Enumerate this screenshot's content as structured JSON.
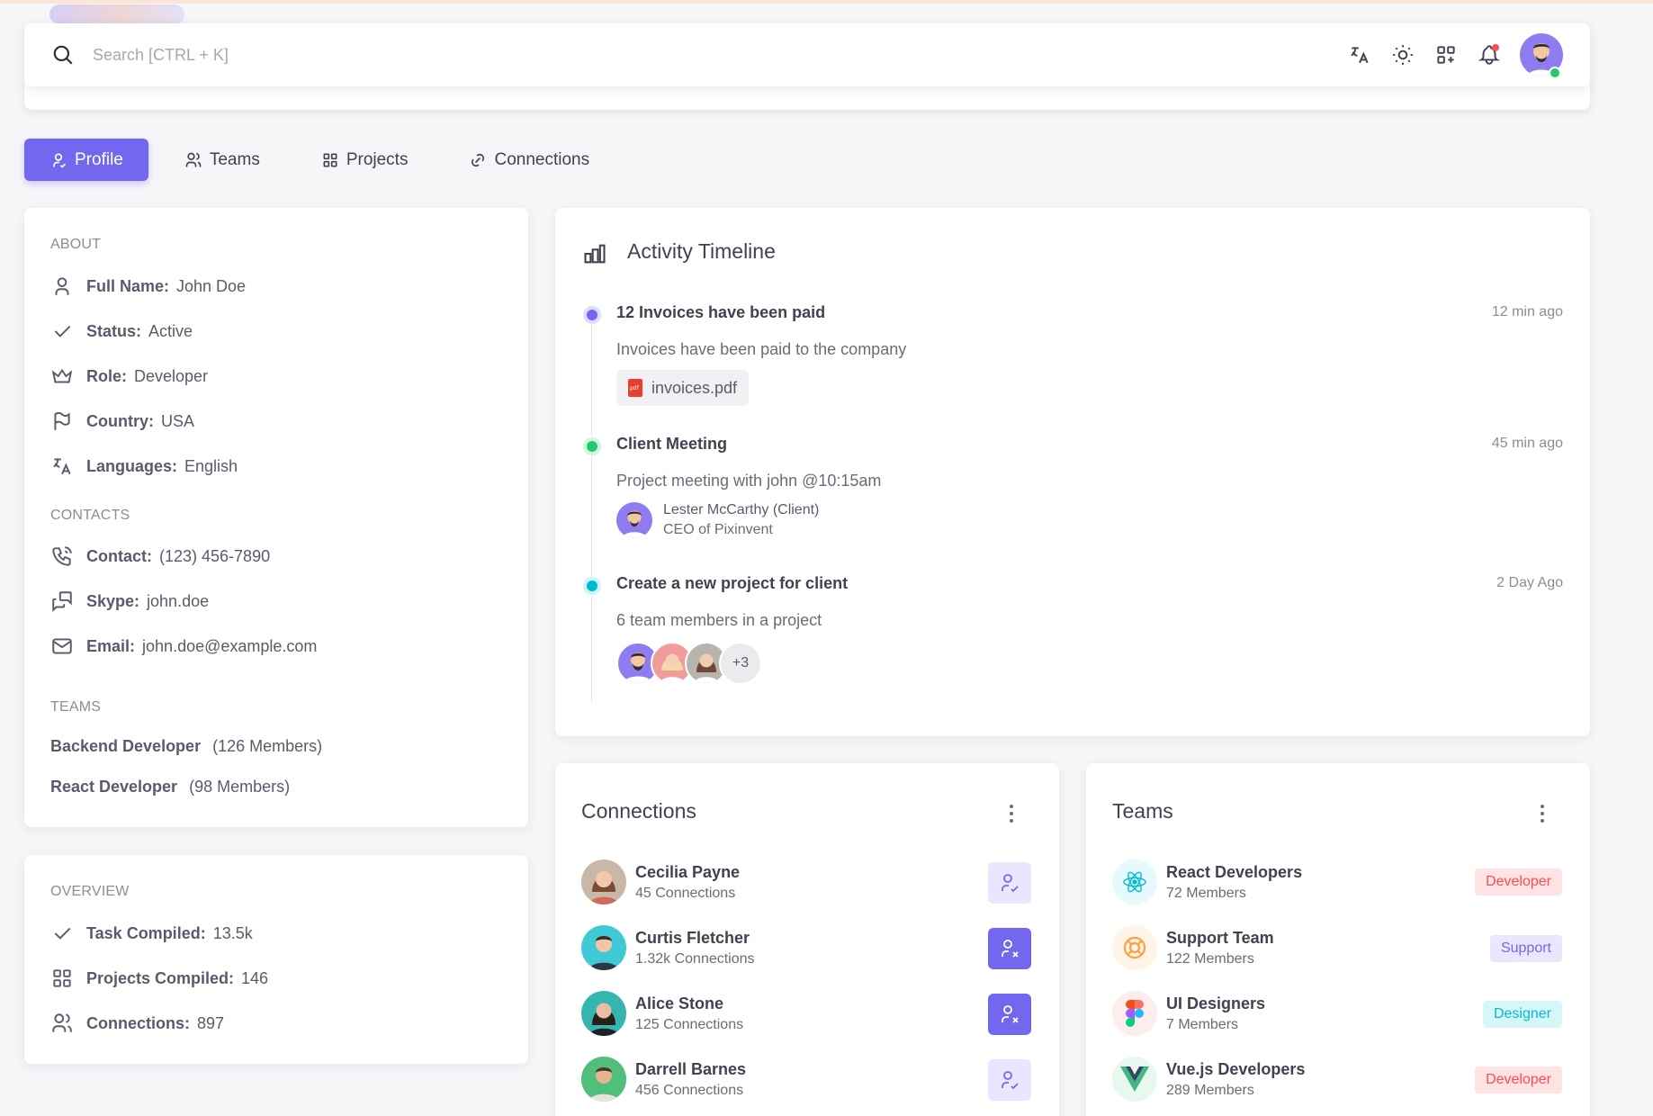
{
  "navbar": {
    "search_placeholder": "Search [CTRL + K]",
    "icons": [
      "translate-icon",
      "sun-icon",
      "apps-icon",
      "bell-icon"
    ]
  },
  "tabs": [
    {
      "label": "Profile",
      "active": true,
      "icon": "user-icon"
    },
    {
      "label": "Teams",
      "active": false,
      "icon": "users-icon"
    },
    {
      "label": "Projects",
      "active": false,
      "icon": "grid-icon"
    },
    {
      "label": "Connections",
      "active": false,
      "icon": "link-icon"
    }
  ],
  "about": {
    "label": "ABOUT",
    "rows": [
      {
        "key": "Full Name:",
        "value": "John Doe",
        "icon": "user-icon"
      },
      {
        "key": "Status:",
        "value": "Active",
        "icon": "check-icon"
      },
      {
        "key": "Role:",
        "value": "Developer",
        "icon": "crown-icon"
      },
      {
        "key": "Country:",
        "value": "USA",
        "icon": "flag-icon"
      },
      {
        "key": "Languages:",
        "value": "English",
        "icon": "translate-icon"
      }
    ]
  },
  "contacts": {
    "label": "CONTACTS",
    "rows": [
      {
        "key": "Contact:",
        "value": "(123) 456-7890",
        "icon": "phone-icon"
      },
      {
        "key": "Skype:",
        "value": "john.doe",
        "icon": "messages-icon"
      },
      {
        "key": "Email:",
        "value": "john.doe@example.com",
        "icon": "mail-icon"
      }
    ]
  },
  "teams_section": {
    "label": "TEAMS",
    "rows": [
      {
        "name": "Backend Developer",
        "members": "(126 Members)"
      },
      {
        "name": "React Developer",
        "members": "(98 Members)"
      }
    ]
  },
  "overview": {
    "label": "OVERVIEW",
    "rows": [
      {
        "key": "Task Compiled:",
        "value": "13.5k",
        "icon": "check-icon"
      },
      {
        "key": "Projects Compiled:",
        "value": "146",
        "icon": "grid-icon"
      },
      {
        "key": "Connections:",
        "value": "897",
        "icon": "users-icon"
      }
    ]
  },
  "timeline": {
    "title": "Activity Timeline",
    "items": [
      {
        "title": "12 Invoices have been paid",
        "time": "12 min ago",
        "text": "Invoices have been paid to the company",
        "color": "#7367f0",
        "attachment": "invoices.pdf"
      },
      {
        "title": "Client Meeting",
        "time": "45 min ago",
        "text": "Project meeting with john @10:15am",
        "color": "#28c76f",
        "client_name": "Lester McCarthy (Client)",
        "client_role": "CEO of Pixinvent"
      },
      {
        "title": "Create a new project for client",
        "time": "2 Day Ago",
        "text": "6 team members in a project",
        "color": "#00bad1",
        "more": "+3"
      }
    ]
  },
  "connections": {
    "title": "Connections",
    "items": [
      {
        "name": "Cecilia Payne",
        "sub": "45 Connections",
        "action": "connected",
        "avatar_bg": "#c9b8a8"
      },
      {
        "name": "Curtis Fletcher",
        "sub": "1.32k Connections",
        "action": "disconnect",
        "avatar_bg": "#3ec9d6"
      },
      {
        "name": "Alice Stone",
        "sub": "125 Connections",
        "action": "disconnect",
        "avatar_bg": "#36b4b0"
      },
      {
        "name": "Darrell Barnes",
        "sub": "456 Connections",
        "action": "connected",
        "avatar_bg": "#4fbf7a"
      }
    ]
  },
  "teams": {
    "title": "Teams",
    "items": [
      {
        "name": "React Developers",
        "sub": "72 Members",
        "badge": "Developer",
        "icon": "react-icon"
      },
      {
        "name": "Support Team",
        "sub": "122 Members",
        "badge": "Support",
        "icon": "lifebuoy-icon"
      },
      {
        "name": "UI Designers",
        "sub": "7 Members",
        "badge": "Designer",
        "icon": "figma-icon"
      },
      {
        "name": "Vue.js Developers",
        "sub": "289 Members",
        "badge": "Developer",
        "icon": "vue-icon"
      }
    ]
  },
  "colors": {
    "primary": "#7367f0",
    "success": "#28c76f",
    "info": "#00bad1",
    "danger": "#ff4c51",
    "danger_bg": "#ffe2e3",
    "primary_bg": "#e9e7fd",
    "info_bg": "#d6f7fa"
  }
}
